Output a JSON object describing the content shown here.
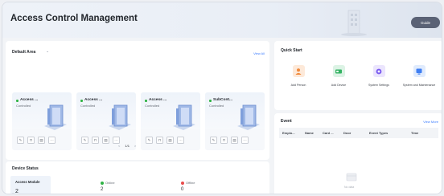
{
  "header": {
    "title": "Access Control Management",
    "guide_label": "Guide"
  },
  "default_area": {
    "title": "Default Area",
    "view_all": "View All",
    "cards": [
      {
        "name": "Access ...",
        "status": "Controlled"
      },
      {
        "name": "Access ...",
        "status": "Controlled"
      },
      {
        "name": "Access ...",
        "status": "Controlled"
      },
      {
        "name": "SubCont...",
        "status": "Controlled"
      }
    ],
    "pager": {
      "prev": "<",
      "page": "1",
      "total": "/1",
      "next": ">"
    }
  },
  "quick_start": {
    "title": "Quick Start",
    "items": [
      {
        "label": "Add Person",
        "icon": "add-person-icon",
        "color": "#f08a3c"
      },
      {
        "label": "Add Device",
        "icon": "add-device-icon",
        "color": "#34b363"
      },
      {
        "label": "System Settings",
        "icon": "gear-icon",
        "color": "#7b5cf0"
      },
      {
        "label": "System and Maintenance",
        "icon": "maintenance-icon",
        "color": "#3f7ff2"
      }
    ]
  },
  "event": {
    "title": "Event",
    "view_more": "View More",
    "columns": [
      "Emplo...",
      "Name",
      "Card ...",
      "Door",
      "Event Types",
      "Time"
    ],
    "empty_text": "No data"
  },
  "device_status": {
    "title": "Device Status",
    "tab_label": "Access Module",
    "tab_prefix": "...",
    "tab_count": "2",
    "online_label": "Online",
    "online_count": "2",
    "offline_label": "Offline",
    "offline_count": "0"
  },
  "colors": {
    "online": "#2fb344",
    "offline": "#e84c4c",
    "link": "#3b7cff"
  }
}
